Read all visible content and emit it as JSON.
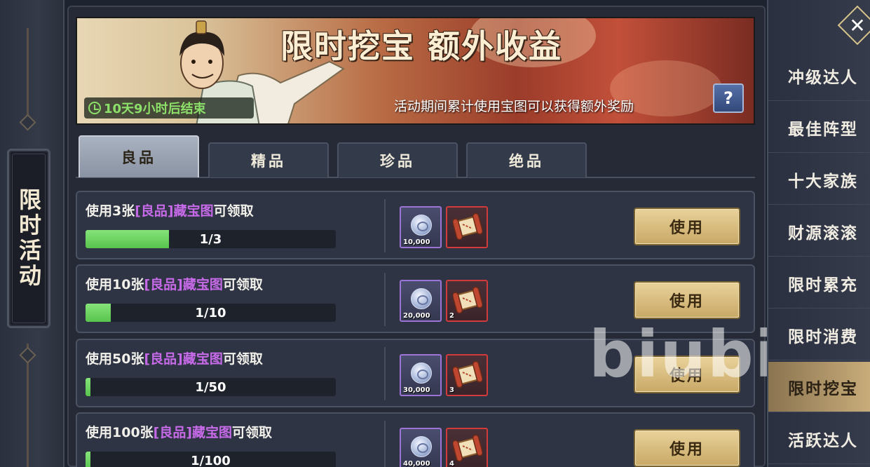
{
  "side_title": "限时活动",
  "banner": {
    "title": "限时挖宝 额外收益",
    "description": "活动期间累计使用宝图可以获得额外奖励",
    "timer": "10天9小时后结束",
    "help_label": "?"
  },
  "tabs": [
    {
      "label": "良品",
      "active": true
    },
    {
      "label": "精品",
      "active": false
    },
    {
      "label": "珍品",
      "active": false
    },
    {
      "label": "绝品",
      "active": false
    }
  ],
  "tasks": [
    {
      "prefix": "使用3张",
      "highlight": "[良品]藏宝图",
      "suffix": "可领取",
      "progress_text": "1/3",
      "progress": 0.333,
      "silver": "10,000",
      "scroll": "",
      "button": "使用"
    },
    {
      "prefix": "使用10张",
      "highlight": "[良品]藏宝图",
      "suffix": "可领取",
      "progress_text": "1/10",
      "progress": 0.1,
      "silver": "20,000",
      "scroll": "2",
      "button": "使用"
    },
    {
      "prefix": "使用50张",
      "highlight": "[良品]藏宝图",
      "suffix": "可领取",
      "progress_text": "1/50",
      "progress": 0.02,
      "silver": "30,000",
      "scroll": "3",
      "button": "使用"
    },
    {
      "prefix": "使用100张",
      "highlight": "[良品]藏宝图",
      "suffix": "可领取",
      "progress_text": "1/100",
      "progress": 0.01,
      "silver": "40,000",
      "scroll": "4",
      "button": "使用"
    }
  ],
  "menu": [
    {
      "label": "冲级达人",
      "active": false
    },
    {
      "label": "最佳阵型",
      "active": false
    },
    {
      "label": "十大家族",
      "active": false
    },
    {
      "label": "财源滚滚",
      "active": false
    },
    {
      "label": "限时累充",
      "active": false
    },
    {
      "label": "限时消费",
      "active": false
    },
    {
      "label": "限时挖宝",
      "active": true
    },
    {
      "label": "活跃达人",
      "active": false
    }
  ],
  "close_label": "✕",
  "watermark": "biubiu",
  "colors": {
    "accent_gold": "#c8a866",
    "progress_green": "#57c44d",
    "highlight_purple": "#c66ae8",
    "timer_green": "#8ce06a"
  },
  "icons": {
    "silver_reward": "silver-coin-icon",
    "scroll_reward": "treasure-map-scroll-icon",
    "timer": "clock-icon"
  }
}
